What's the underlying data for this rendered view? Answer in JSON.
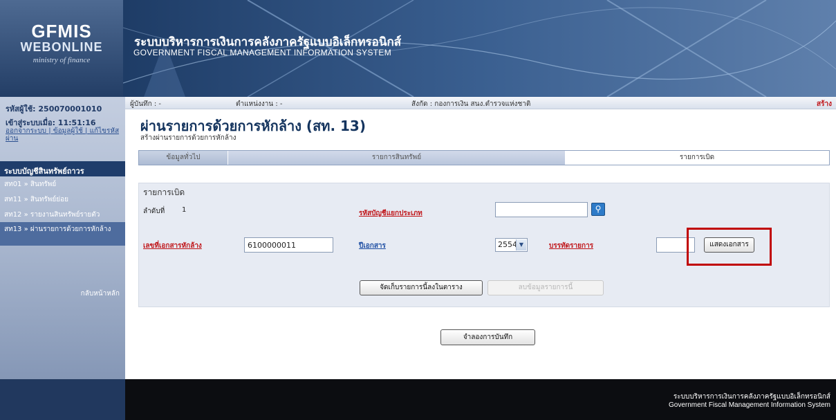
{
  "logo": {
    "line1": "GFMIS",
    "line2": "WEBONLINE",
    "line3": "ministry of finance"
  },
  "header": {
    "title_thai": "ระบบบริหารการเงินการคลังภาครัฐแบบอิเล็กทรอนิกส์",
    "title_eng": "GOVERNMENT FISCAL MANAGEMENT INFORMATION SYSTEM"
  },
  "sidebar": {
    "user_id": "รหัสผู้ใช้: 250070001010",
    "session": "เข้าสู่ระบบเมื่อ: 11:51:16",
    "links": [
      "ออกจากระบบ",
      "ข้อมูลผู้ใช้",
      "แก้ไขรหัสผ่าน"
    ],
    "menu_title": "ระบบบัญชีสินทรัพย์ถาวร",
    "items": [
      {
        "label": "สท01 » สินทรัพย์"
      },
      {
        "label": "สท11 » สินทรัพย์ย่อย"
      },
      {
        "label": "สท12 » รายงานสินทรัพย์รายตัว"
      },
      {
        "label": "สท13 » ผ่านรายการด้วยการหักล้าง"
      }
    ],
    "back_home": "กลับหน้าหลัก"
  },
  "infobar": {
    "recorder": "ผู้บันทึก : -",
    "position": "ตำแหน่งงาน : -",
    "affiliation": "สังกัด : กองการเงิน สนง.ตำรวจแห่งชาติ",
    "mode": "สร้าง"
  },
  "page": {
    "title": "ผ่านรายการด้วยการหักล้าง (สท. 13)",
    "subtitle": "สร้างผ่านรายการด้วยการหักล้าง"
  },
  "tabs": [
    {
      "label": "ข้อมูลทั่วไป"
    },
    {
      "label": "รายการสินทรัพย์"
    },
    {
      "label": "รายการเบิด"
    }
  ],
  "form": {
    "section_label": "รายการเบิด",
    "seq_label": "ลำดับที่",
    "seq_value": "1",
    "gl_label": "รหัสบัญชีแยกประเภท",
    "gl_value": "",
    "clear_doc_label": "เลขที่เอกสารหักล้าง",
    "clear_doc_value": "6100000011",
    "doc_year_label": "ปีเอกสาร",
    "doc_year_value": "2554",
    "line_item_label": "บรรทัดรายการ",
    "line_item_value": "",
    "show_doc_button": "แสดงเอกสาร",
    "save_row_button": "จัดเก็บรายการนี้ลงในตาราง",
    "delete_row_button": "ลบข้อมูลรายการนี้"
  },
  "simulate_button": "จำลองการบันทึก",
  "footer": {
    "thai": "ระบบบริหารการเงินการคลังภาครัฐแบบอิเล็กทรอนิกส์",
    "eng": "Government Fiscal Management Information System"
  },
  "colors": {
    "highlight": "#c00000",
    "header": "#20406b",
    "required_link": "#c0161a"
  }
}
